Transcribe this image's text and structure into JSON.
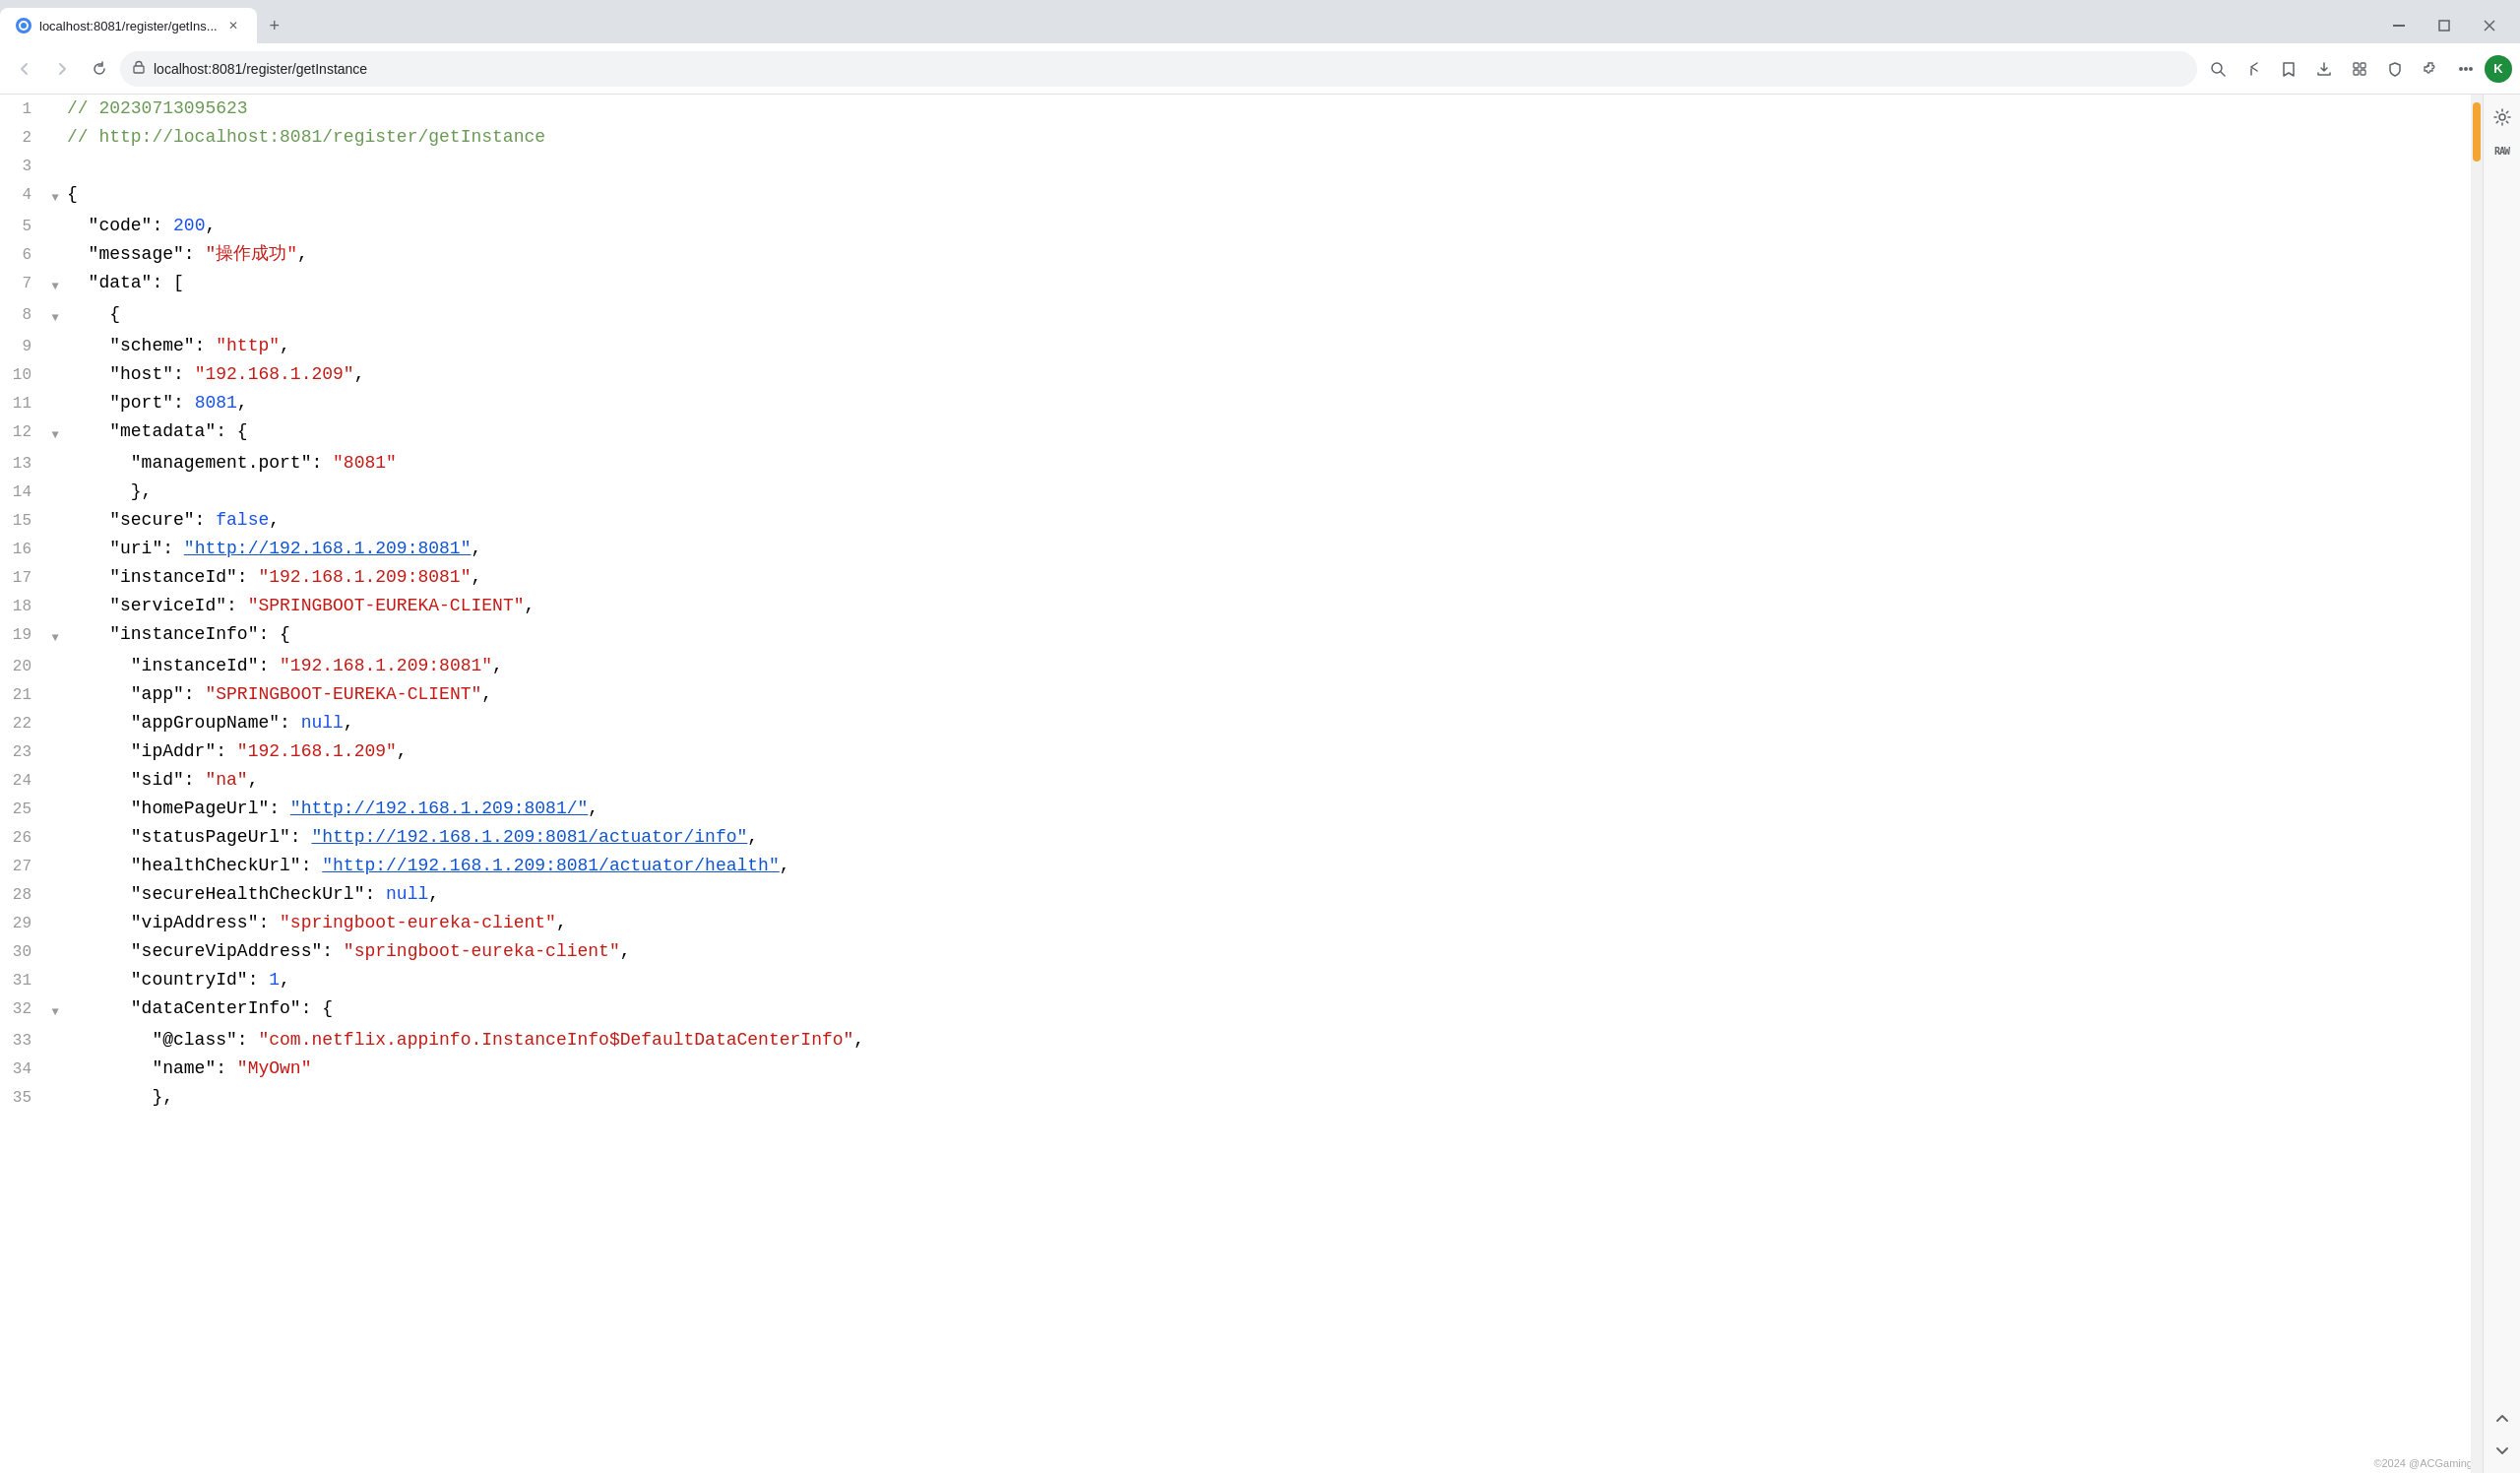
{
  "browser": {
    "tab_title": "localhost:8081/register/getIns...",
    "tab_favicon": "🌐",
    "new_tab_label": "+",
    "address": "localhost:8081/register/getInstance",
    "window_minimize": "–",
    "window_maximize": "□",
    "window_close": "✕",
    "nav_back": "←",
    "nav_forward": "→",
    "nav_reload": "↻"
  },
  "lines": [
    {
      "num": 1,
      "arrow": "",
      "indent": 0,
      "content": "// 20230713095623",
      "type": "comment"
    },
    {
      "num": 2,
      "arrow": "",
      "indent": 0,
      "content": "// http://localhost:8081/register/getInstance",
      "type": "comment"
    },
    {
      "num": 3,
      "arrow": "",
      "indent": 0,
      "content": "",
      "type": "empty"
    },
    {
      "num": 4,
      "arrow": "expanded",
      "indent": 0,
      "content": "{",
      "type": "punct"
    },
    {
      "num": 5,
      "arrow": "",
      "indent": 1,
      "content": "\"code\": 200,",
      "type": "mixed",
      "parts": [
        {
          "text": "  \"code\": ",
          "class": "c-key"
        },
        {
          "text": "200",
          "class": "c-number"
        },
        {
          "text": ",",
          "class": "c-punct"
        }
      ]
    },
    {
      "num": 6,
      "arrow": "",
      "indent": 1,
      "content": "\"message\": \"操作成功\",",
      "type": "mixed",
      "parts": [
        {
          "text": "  \"message\": ",
          "class": "c-key"
        },
        {
          "text": "\"操作成功\"",
          "class": "c-string"
        },
        {
          "text": ",",
          "class": "c-punct"
        }
      ]
    },
    {
      "num": 7,
      "arrow": "expanded",
      "indent": 1,
      "content": "\"data\": [",
      "type": "mixed",
      "parts": [
        {
          "text": "  \"data\": ",
          "class": "c-key"
        },
        {
          "text": "[",
          "class": "c-punct"
        }
      ]
    },
    {
      "num": 8,
      "arrow": "expanded",
      "indent": 2,
      "content": "  {",
      "type": "punct"
    },
    {
      "num": 9,
      "arrow": "",
      "indent": 3,
      "content": "\"scheme\": \"http\",",
      "type": "mixed",
      "parts": [
        {
          "text": "    \"scheme\": ",
          "class": "c-key"
        },
        {
          "text": "\"http\"",
          "class": "c-string"
        },
        {
          "text": ",",
          "class": "c-punct"
        }
      ]
    },
    {
      "num": 10,
      "arrow": "",
      "indent": 3,
      "content": "\"host\": \"192.168.1.209\",",
      "type": "mixed",
      "parts": [
        {
          "text": "    \"host\": ",
          "class": "c-key"
        },
        {
          "text": "\"192.168.1.209\"",
          "class": "c-string"
        },
        {
          "text": ",",
          "class": "c-punct"
        }
      ]
    },
    {
      "num": 11,
      "arrow": "",
      "indent": 3,
      "content": "\"port\": 8081,",
      "type": "mixed",
      "parts": [
        {
          "text": "    \"port\": ",
          "class": "c-key"
        },
        {
          "text": "8081",
          "class": "c-number"
        },
        {
          "text": ",",
          "class": "c-punct"
        }
      ]
    },
    {
      "num": 12,
      "arrow": "expanded",
      "indent": 3,
      "content": "\"metadata\": {",
      "type": "mixed",
      "parts": [
        {
          "text": "    \"metadata\": ",
          "class": "c-key"
        },
        {
          "text": "{",
          "class": "c-punct"
        }
      ]
    },
    {
      "num": 13,
      "arrow": "",
      "indent": 4,
      "content": "\"management.port\": \"8081\"",
      "type": "mixed",
      "parts": [
        {
          "text": "      \"management.port\": ",
          "class": "c-key"
        },
        {
          "text": "\"8081\"",
          "class": "c-string"
        }
      ]
    },
    {
      "num": 14,
      "arrow": "",
      "indent": 3,
      "content": "},",
      "type": "punct"
    },
    {
      "num": 15,
      "arrow": "",
      "indent": 3,
      "content": "\"secure\": false,",
      "type": "mixed",
      "parts": [
        {
          "text": "    \"secure\": ",
          "class": "c-key"
        },
        {
          "text": "false",
          "class": "c-bool"
        },
        {
          "text": ",",
          "class": "c-punct"
        }
      ]
    },
    {
      "num": 16,
      "arrow": "",
      "indent": 3,
      "content": "\"uri\": \"http://192.168.1.209:8081\",",
      "type": "mixed",
      "parts": [
        {
          "text": "    \"uri\": ",
          "class": "c-key"
        },
        {
          "text": "\"http://192.168.1.209:8081\"",
          "class": "c-link"
        },
        {
          "text": ",",
          "class": "c-punct"
        }
      ]
    },
    {
      "num": 17,
      "arrow": "",
      "indent": 3,
      "content": "\"instanceId\": \"192.168.1.209:8081\",",
      "type": "mixed",
      "parts": [
        {
          "text": "    \"instanceId\": ",
          "class": "c-key"
        },
        {
          "text": "\"192.168.1.209:8081\"",
          "class": "c-string"
        },
        {
          "text": ",",
          "class": "c-punct"
        }
      ]
    },
    {
      "num": 18,
      "arrow": "",
      "indent": 3,
      "content": "\"serviceId\": \"SPRINGBOOT-EUREKA-CLIENT\",",
      "type": "mixed",
      "parts": [
        {
          "text": "    \"serviceId\": ",
          "class": "c-key"
        },
        {
          "text": "\"SPRINGBOOT-EUREKA-CLIENT\"",
          "class": "c-string"
        },
        {
          "text": ",",
          "class": "c-punct"
        }
      ]
    },
    {
      "num": 19,
      "arrow": "expanded",
      "indent": 3,
      "content": "\"instanceInfo\": {",
      "type": "mixed",
      "parts": [
        {
          "text": "    \"instanceInfo\": ",
          "class": "c-key"
        },
        {
          "text": "{",
          "class": "c-punct"
        }
      ]
    },
    {
      "num": 20,
      "arrow": "",
      "indent": 4,
      "content": "\"instanceId\": \"192.168.1.209:8081\",",
      "type": "mixed",
      "parts": [
        {
          "text": "      \"instanceId\": ",
          "class": "c-key"
        },
        {
          "text": "\"192.168.1.209:8081\"",
          "class": "c-string"
        },
        {
          "text": ",",
          "class": "c-punct"
        }
      ]
    },
    {
      "num": 21,
      "arrow": "",
      "indent": 4,
      "content": "\"app\": \"SPRINGBOOT-EUREKA-CLIENT\",",
      "type": "mixed",
      "parts": [
        {
          "text": "      \"app\": ",
          "class": "c-key"
        },
        {
          "text": "\"SPRINGBOOT-EUREKA-CLIENT\"",
          "class": "c-string"
        },
        {
          "text": ",",
          "class": "c-punct"
        }
      ]
    },
    {
      "num": 22,
      "arrow": "",
      "indent": 4,
      "content": "\"appGroupName\": null,",
      "type": "mixed",
      "parts": [
        {
          "text": "      \"appGroupName\": ",
          "class": "c-key"
        },
        {
          "text": "null",
          "class": "c-null"
        },
        {
          "text": ",",
          "class": "c-punct"
        }
      ]
    },
    {
      "num": 23,
      "arrow": "",
      "indent": 4,
      "content": "\"ipAddr\": \"192.168.1.209\",",
      "type": "mixed",
      "parts": [
        {
          "text": "      \"ipAddr\": ",
          "class": "c-key"
        },
        {
          "text": "\"192.168.1.209\"",
          "class": "c-string"
        },
        {
          "text": ",",
          "class": "c-punct"
        }
      ]
    },
    {
      "num": 24,
      "arrow": "",
      "indent": 4,
      "content": "\"sid\": \"na\",",
      "type": "mixed",
      "parts": [
        {
          "text": "      \"sid\": ",
          "class": "c-key"
        },
        {
          "text": "\"na\"",
          "class": "c-string"
        },
        {
          "text": ",",
          "class": "c-punct"
        }
      ]
    },
    {
      "num": 25,
      "arrow": "",
      "indent": 4,
      "content": "\"homePageUrl\": \"http://192.168.1.209:8081/\",",
      "type": "mixed",
      "parts": [
        {
          "text": "      \"homePageUrl\": ",
          "class": "c-key"
        },
        {
          "text": "\"http://192.168.1.209:8081/\"",
          "class": "c-link"
        },
        {
          "text": ",",
          "class": "c-punct"
        }
      ]
    },
    {
      "num": 26,
      "arrow": "",
      "indent": 4,
      "content": "\"statusPageUrl\": \"http://192.168.1.209:8081/actuator/info\",",
      "type": "mixed",
      "parts": [
        {
          "text": "      \"statusPageUrl\": ",
          "class": "c-key"
        },
        {
          "text": "\"http://192.168.1.209:8081/actuator/info\"",
          "class": "c-link"
        },
        {
          "text": ",",
          "class": "c-punct"
        }
      ]
    },
    {
      "num": 27,
      "arrow": "",
      "indent": 4,
      "content": "\"healthCheckUrl\": \"http://192.168.1.209:8081/actuator/health\",",
      "type": "mixed",
      "parts": [
        {
          "text": "      \"healthCheckUrl\": ",
          "class": "c-key"
        },
        {
          "text": "\"http://192.168.1.209:8081/actuator/health\"",
          "class": "c-link"
        },
        {
          "text": ",",
          "class": "c-punct"
        }
      ]
    },
    {
      "num": 28,
      "arrow": "",
      "indent": 4,
      "content": "\"secureHealthCheckUrl\": null,",
      "type": "mixed",
      "parts": [
        {
          "text": "      \"secureHealthCheckUrl\": ",
          "class": "c-key"
        },
        {
          "text": "null",
          "class": "c-null"
        },
        {
          "text": ",",
          "class": "c-punct"
        }
      ]
    },
    {
      "num": 29,
      "arrow": "",
      "indent": 4,
      "content": "\"vipAddress\": \"springboot-eureka-client\",",
      "type": "mixed",
      "parts": [
        {
          "text": "      \"vipAddress\": ",
          "class": "c-key"
        },
        {
          "text": "\"springboot-eureka-client\"",
          "class": "c-string"
        },
        {
          "text": ",",
          "class": "c-punct"
        }
      ]
    },
    {
      "num": 30,
      "arrow": "",
      "indent": 4,
      "content": "\"secureVipAddress\": \"springboot-eureka-client\",",
      "type": "mixed",
      "parts": [
        {
          "text": "      \"secureVipAddress\": ",
          "class": "c-key"
        },
        {
          "text": "\"springboot-eureka-client\"",
          "class": "c-string"
        },
        {
          "text": ",",
          "class": "c-punct"
        }
      ]
    },
    {
      "num": 31,
      "arrow": "",
      "indent": 4,
      "content": "\"countryId\": 1,",
      "type": "mixed",
      "parts": [
        {
          "text": "      \"countryId\": ",
          "class": "c-key"
        },
        {
          "text": "1",
          "class": "c-number"
        },
        {
          "text": ",",
          "class": "c-punct"
        }
      ]
    },
    {
      "num": 32,
      "arrow": "expanded",
      "indent": 4,
      "content": "\"dataCenterInfo\": {",
      "type": "mixed",
      "parts": [
        {
          "text": "      \"dataCenterInfo\": ",
          "class": "c-key"
        },
        {
          "text": "{",
          "class": "c-punct"
        }
      ]
    },
    {
      "num": 33,
      "arrow": "",
      "indent": 5,
      "content": "\"@class\": \"com.netflix.appinfo.InstanceInfo$DefaultDataCenterInfo\",",
      "type": "mixed",
      "parts": [
        {
          "text": "        \"@class\": ",
          "class": "c-key"
        },
        {
          "text": "\"com.netflix.appinfo.InstanceInfo$DefaultDataCenterInfo\"",
          "class": "c-string"
        },
        {
          "text": ",",
          "class": "c-punct"
        }
      ]
    },
    {
      "num": 34,
      "arrow": "",
      "indent": 5,
      "content": "\"name\": \"MyOwn\"",
      "type": "mixed",
      "parts": [
        {
          "text": "        \"name\": ",
          "class": "c-key"
        },
        {
          "text": "\"MyOwn\"",
          "class": "c-string"
        }
      ]
    },
    {
      "num": 35,
      "arrow": "",
      "indent": 4,
      "content": "},",
      "type": "punct"
    }
  ],
  "sidebar": {
    "gear_title": "Settings",
    "raw_title": "RAW",
    "up_title": "Scroll Up",
    "down_title": "Scroll Down"
  },
  "footer": {
    "credit": "©2024 @ACGaming"
  }
}
